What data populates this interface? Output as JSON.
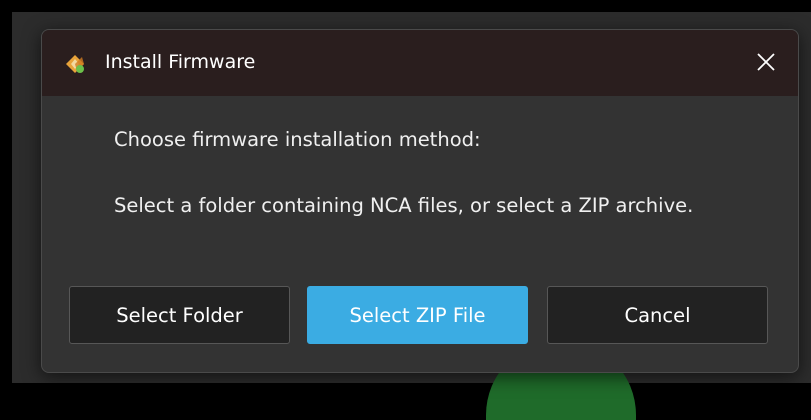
{
  "dialog": {
    "title": "Install Firmware",
    "close_icon": "close-icon",
    "app_icon": "app-logo-icon",
    "prompt": "Choose firmware installation method:",
    "description": "Select a folder containing NCA files, or select a ZIP archive."
  },
  "buttons": {
    "select_folder": "Select Folder",
    "select_zip": "Select ZIP File",
    "cancel": "Cancel"
  },
  "colors": {
    "accent": "#3bace3",
    "titlebar": "#2a1e1e",
    "dialog_bg": "#333333",
    "button_bg": "#222222"
  }
}
